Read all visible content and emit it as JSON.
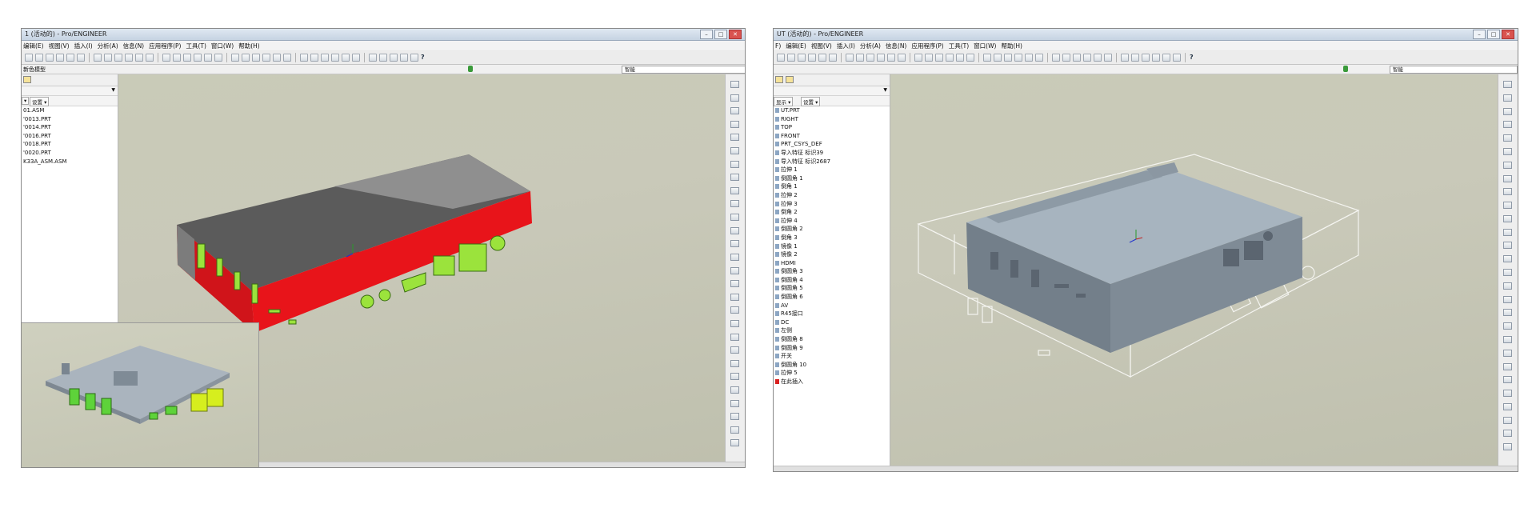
{
  "left_window": {
    "title": "1 (活动的) - Pro/ENGINEER",
    "menu": [
      "编辑(E)",
      "视图(V)",
      "插入(I)",
      "分析(A)",
      "信息(N)",
      "应用程序(P)",
      "工具(T)",
      "窗口(W)",
      "帮助(H)"
    ],
    "panel_label": "新色模型",
    "filter_value": "智能",
    "settings_label": "设置",
    "tree_items": [
      "01.ASM",
      "'0013.PRT",
      "'0014.PRT",
      "'0016.PRT",
      "'0018.PRT",
      "'0020.PRT",
      "K33A_ASM.ASM"
    ]
  },
  "right_window": {
    "title": "UT (活动的) - Pro/ENGINEER",
    "menu": [
      "F)",
      "编辑(E)",
      "视图(V)",
      "插入(I)",
      "分析(A)",
      "信息(N)",
      "应用程序(P)",
      "工具(T)",
      "窗口(W)",
      "帮助(H)"
    ],
    "filter_value": "智能",
    "show_label": "显示",
    "settings_label": "设置",
    "tree_items": [
      "UT.PRT",
      "RIGHT",
      "TOP",
      "FRONT",
      "PRT_CSYS_DEF",
      "导入特征 标识39",
      "导入特征 标识2687",
      "拉伸 1",
      "倒圆角 1",
      "倒角 1",
      "拉伸 2",
      "拉伸 3",
      "倒角 2",
      "拉伸 4",
      "倒圆角 2",
      "倒角 3",
      "镜像 1",
      "镜像 2",
      "HDMI",
      "倒圆角 3",
      "倒圆角 4",
      "倒圆角 5",
      "倒圆角 6",
      "AV",
      "R45接口",
      "DC",
      "左侧",
      "倒圆角 8",
      "倒圆角 9",
      "开关",
      "倒圆角 10",
      "拉伸 5",
      "在此插入"
    ]
  },
  "colors": {
    "case_red": "#e8141a",
    "case_dark_top": "#5b5b5b",
    "port_green": "#9be33c",
    "model_grey": "#a3b0bb",
    "viewport_bg": "#c9cbb8"
  },
  "icons": {
    "toolbar": "toolbar-button-icon",
    "help": "context-help-icon",
    "csys": "csys-axis-icon"
  }
}
